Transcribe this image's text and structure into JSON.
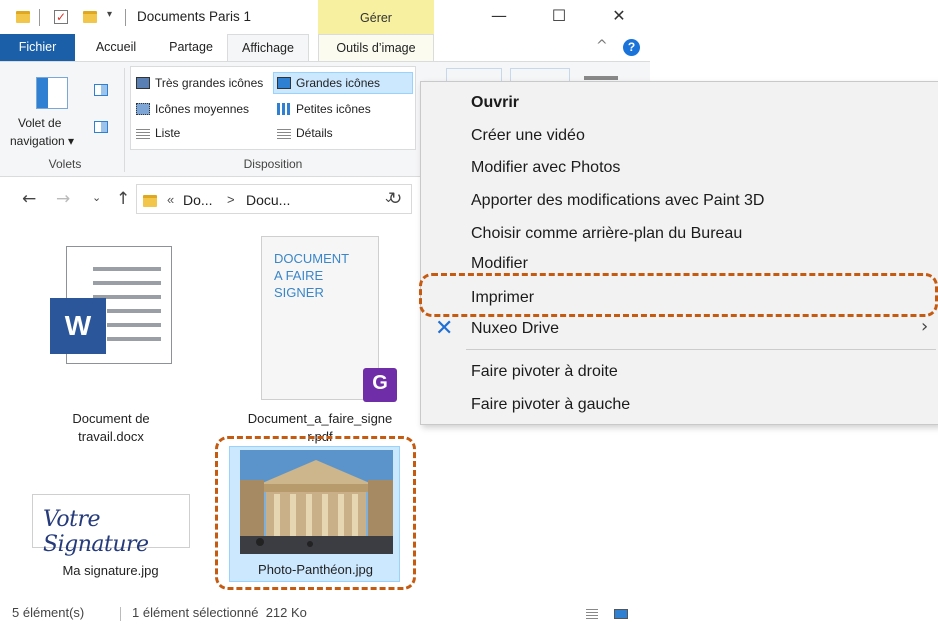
{
  "window": {
    "title": "Documents Paris 1",
    "manage_tab": "Gérer"
  },
  "ribbon": {
    "tabs": [
      "Fichier",
      "Accueil",
      "Partage",
      "Affichage",
      "Outils d’image"
    ],
    "nav_pane": {
      "label_line1": "Volet de",
      "label_line2": "navigation ▾"
    },
    "groups": {
      "panes": "Volets",
      "layout": "Disposition"
    },
    "layout_options": {
      "very_large": "Très grandes icônes",
      "large": "Grandes icônes",
      "medium": "Icônes moyennes",
      "small": "Petites icônes",
      "list": "Liste",
      "details": "Détails"
    }
  },
  "address": {
    "breadcrumb_prefix": "«",
    "segment1": "Do...",
    "separator": ">",
    "segment2": "Docu..."
  },
  "files": [
    {
      "name_line1": "Document de",
      "name_line2": "travail.docx"
    },
    {
      "name_line1": "Document_a_faire_signe",
      "name_line2": "r.pdf",
      "thumb_text": [
        "DOCUMENT",
        "A FAIRE",
        "SIGNER"
      ]
    },
    {
      "name": "Ma signature.jpg",
      "thumb_text": "Votre Signature"
    },
    {
      "name": "Photo-Panthéon.jpg"
    }
  ],
  "context_menu": {
    "items": [
      "Ouvrir",
      "Créer une vidéo",
      "Modifier avec Photos",
      "Apporter des modifications avec Paint 3D",
      "Choisir comme arrière-plan du Bureau",
      "Modifier",
      "Imprimer",
      "Nuxeo Drive",
      "Faire pivoter à droite",
      "Faire pivoter à gauche"
    ]
  },
  "status": {
    "count": "5 élément(s)",
    "selection": "1 élément sélectionné  212 Ko"
  },
  "colors": {
    "accent": "#1a5fa8",
    "selection": "#cce8ff",
    "highlight": "#c55a11",
    "manage_tab": "#f7f0a0"
  }
}
